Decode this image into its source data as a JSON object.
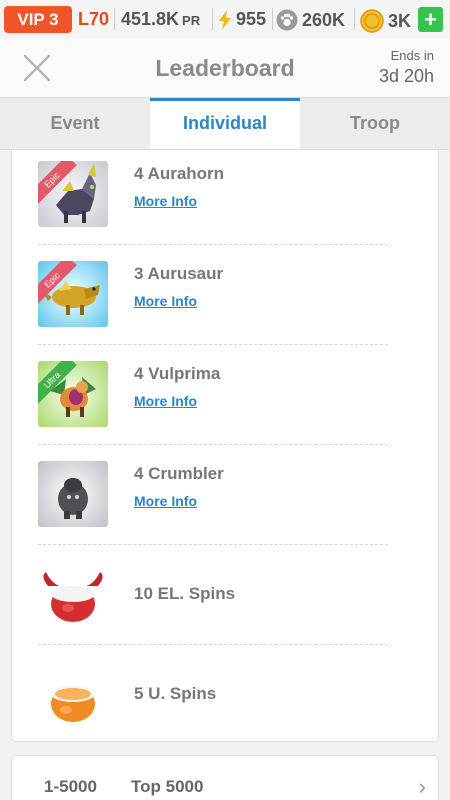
{
  "status": {
    "vip": "VIP 3",
    "level": "L70",
    "pr_value": "451.8K",
    "pr_unit": "PR",
    "energy": "955",
    "food": "260K",
    "coins": "3K",
    "plus": "+"
  },
  "header": {
    "title": "Leaderboard",
    "ends_label": "Ends in",
    "ends_value": "3d 20h"
  },
  "tabs": [
    {
      "label": "Event"
    },
    {
      "label": "Individual"
    },
    {
      "label": "Troop"
    }
  ],
  "rewards": [
    {
      "name": "4 Aurahorn",
      "more": "More Info",
      "badge": "Epic"
    },
    {
      "name": "3 Aurusaur",
      "more": "More Info",
      "badge": "Epic"
    },
    {
      "name": "4 Vulprima",
      "more": "More Info",
      "badge": "Ultra"
    },
    {
      "name": "4 Crumbler",
      "more": "More Info"
    },
    {
      "name": "10 EL. Spins"
    },
    {
      "name": "5 U. Spins"
    }
  ],
  "bottom": {
    "range": "1-5000",
    "label": "Top 5000"
  },
  "colors": {
    "accent": "#2a86c8",
    "vip": "#f0552a",
    "plus": "#37c24e",
    "epic": "#e05a6a",
    "ultra": "#43b04a"
  }
}
